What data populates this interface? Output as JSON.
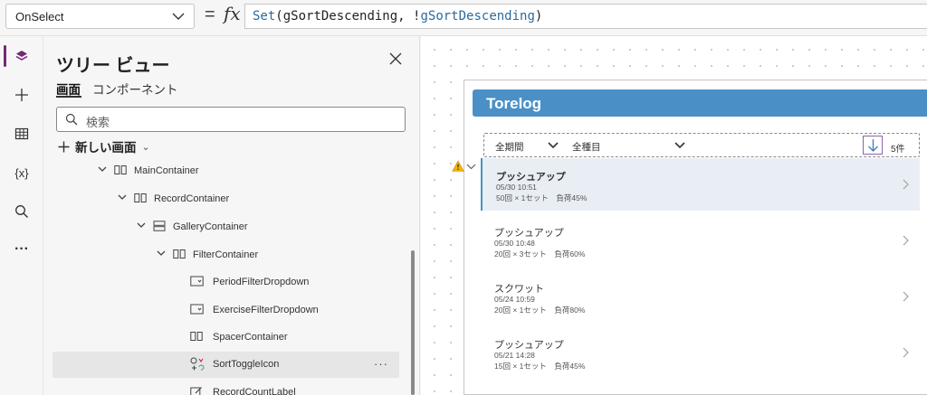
{
  "formula_bar": {
    "property": "OnSelect",
    "equals": "=",
    "fx_label": "fx",
    "formula_fn": "Set",
    "formula_open": "(",
    "formula_var1": "gSortDescending",
    "formula_sep": ", !",
    "formula_var2": "gSortDescending",
    "formula_close": ")"
  },
  "rail": {
    "items": [
      "layers-icon",
      "plus-icon",
      "table-icon",
      "variables-icon",
      "search-icon",
      "more-icon"
    ],
    "variables_text": "{x}",
    "more_text": "···"
  },
  "tree": {
    "title": "ツリー ビュー",
    "tabs": [
      {
        "label": "画面",
        "active": true
      },
      {
        "label": "コンポーネント",
        "active": false
      }
    ],
    "search_placeholder": "検索",
    "new_screen": "新しい画面",
    "nodes": [
      {
        "label": "MainContainer"
      },
      {
        "label": "RecordContainer"
      },
      {
        "label": "GalleryContainer"
      },
      {
        "label": "FilterContainer"
      },
      {
        "label": "PeriodFilterDropdown"
      },
      {
        "label": "ExerciseFilterDropdown"
      },
      {
        "label": "SpacerContainer"
      },
      {
        "label": "SortToggleIcon"
      },
      {
        "label": "RecordCountLabel"
      }
    ],
    "more_label": "···"
  },
  "app": {
    "title": "Torelog",
    "period_filter": "全期間",
    "exercise_filter": "全種目",
    "count": "5件",
    "records": [
      {
        "name": "プッシュアップ",
        "date": "05/30 10:51",
        "detail": "50回 × 1セット　負荷45%"
      },
      {
        "name": "プッシュアップ",
        "date": "05/30 10:48",
        "detail": "20回 × 3セット　負荷60%"
      },
      {
        "name": "スクワット",
        "date": "05/24 10:59",
        "detail": "20回 × 1セット　負荷80%"
      },
      {
        "name": "プッシュアップ",
        "date": "05/21 14:28",
        "detail": "15回 × 1セット　負荷45%"
      }
    ]
  },
  "colors": {
    "accent": "#742774",
    "header_blue": "#4a90c7",
    "warning": "#f2b600"
  }
}
